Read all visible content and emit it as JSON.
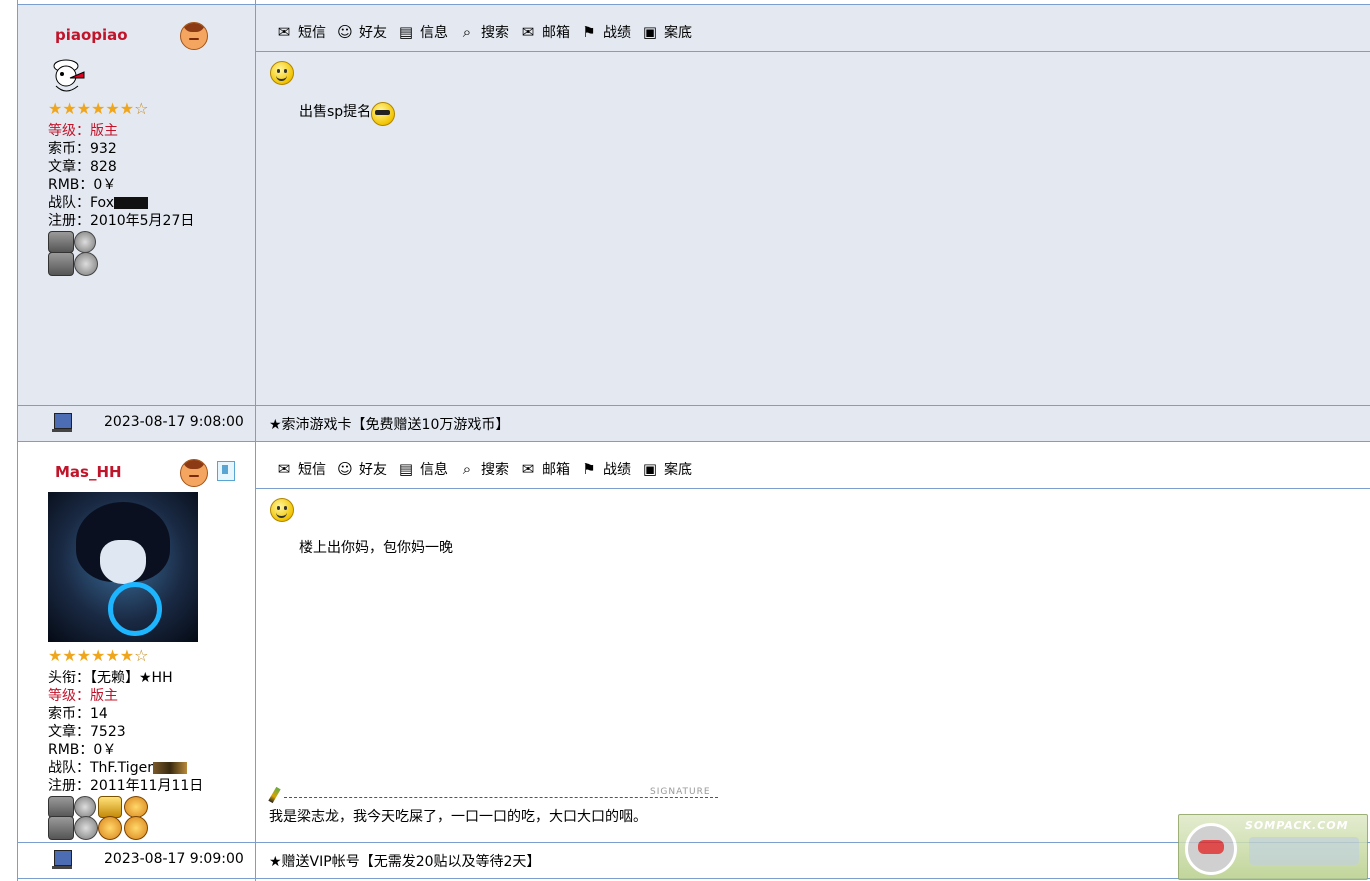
{
  "toolbar": {
    "items": [
      {
        "label": "短信",
        "icon": "sms-icon",
        "glyph": "✉"
      },
      {
        "label": "好友",
        "icon": "friends-icon",
        "glyph": "👥"
      },
      {
        "label": "信息",
        "icon": "info-icon",
        "glyph": "📋"
      },
      {
        "label": "搜索",
        "icon": "search-icon",
        "glyph": "🔍"
      },
      {
        "label": "邮箱",
        "icon": "mail-icon",
        "glyph": "📨"
      },
      {
        "label": "战绩",
        "icon": "record-icon",
        "glyph": "🏃"
      },
      {
        "label": "案底",
        "icon": "file-icon",
        "glyph": "📇"
      }
    ]
  },
  "posts": [
    {
      "username": "piaopiao",
      "stars": "★★★★★★",
      "star_empty": "☆",
      "rank_label": "等级：版主",
      "coins": "索币：932",
      "articles": "文章：828",
      "rmb": "RMB：0￥",
      "team": "战队：Fox",
      "register": "注册：2010年5月27日",
      "message": "出售sp提名",
      "time": "2023-08-17 9:08:00",
      "ad": "★索沛游戏卡【免费赠送10万游戏币】"
    },
    {
      "username": "Mas_HH",
      "stars": "★★★★★★",
      "star_empty": "☆",
      "title": "头衔：【无赖】★HH",
      "rank_label": "等级：版主",
      "coins": "索币：14",
      "articles": "文章：7523",
      "rmb": "RMB：0￥",
      "team": "战队：ThF.Tiger",
      "register": "注册：2011年11月11日",
      "message": "楼上出你妈，包你妈一晚",
      "signature_label": "SIGNATURE",
      "signature": "我是梁志龙，我今天吃屎了，一口一口的吃，大口大口的咽。",
      "time": "2023-08-17 9:09:00",
      "ad": "★赠送VIP帐号【无需发20贴以及等待2天】"
    }
  ],
  "watermark": {
    "text": "SOMPACK.COM"
  },
  "colors": {
    "border": "#7a9fcf",
    "post_bg": "#e4e9f1",
    "username": "#c0142a",
    "star": "#f0a61c"
  }
}
